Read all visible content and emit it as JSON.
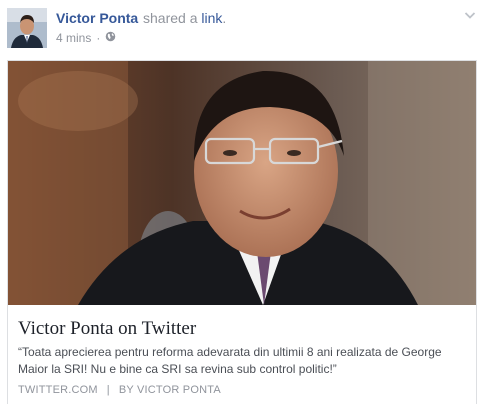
{
  "post": {
    "author": "Victor Ponta",
    "action_text": "shared a",
    "action_link": "link",
    "action_end": ".",
    "timestamp": "4 mins",
    "separator": "·",
    "audience_icon": "globe-icon"
  },
  "card": {
    "title": "Victor Ponta on Twitter",
    "description": "“Toata aprecierea pentru reforma adevarata din ultimii 8 ani realizata de George Maior la SRI! Nu e bine ca SRI sa revina sub control politic!”",
    "domain": "TWITTER.COM",
    "divider": "|",
    "byline": "BY VICTOR PONTA"
  },
  "colors": {
    "author_link": "#365899",
    "meta_gray": "#90949c",
    "title_text": "#1d2129",
    "body_text": "#4b4f56",
    "card_border": "#dddfe2"
  }
}
